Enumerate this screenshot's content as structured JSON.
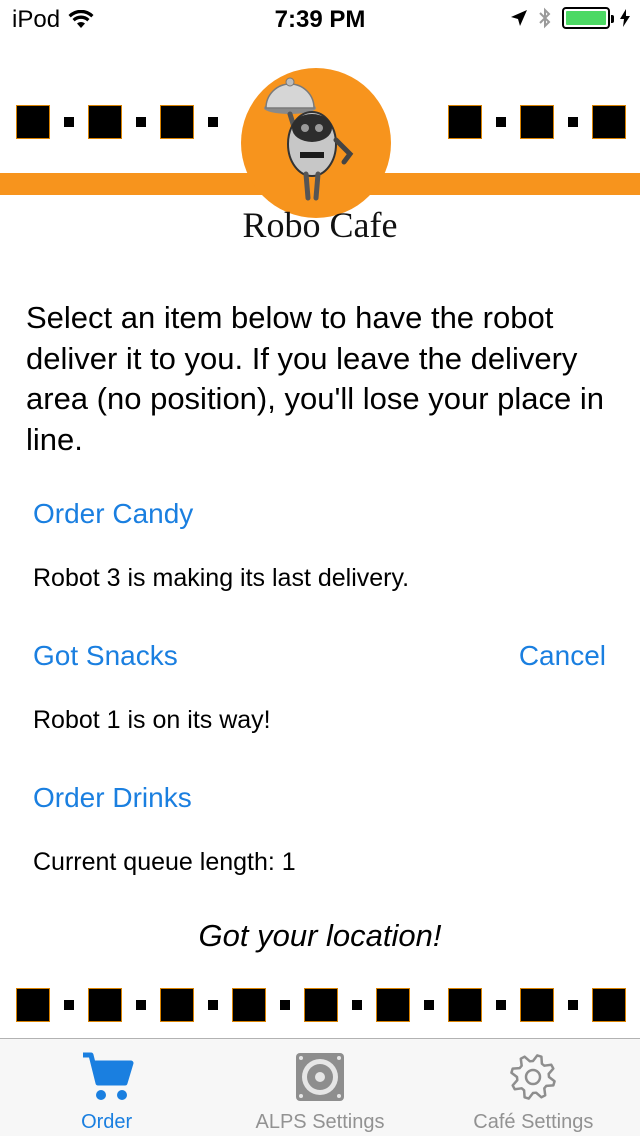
{
  "status_bar": {
    "carrier": "iPod",
    "time": "7:39 PM"
  },
  "header": {
    "title": "Robo Cafe",
    "brand_color": "#f7941d"
  },
  "intro_text": "Select an item below to have the robot deliver it to you. If you leave the delivery area (no position), you'll lose your place in line.",
  "orders": [
    {
      "button_label": "Order Candy",
      "status": "Robot 3 is making its last delivery."
    },
    {
      "button_label": "Got Snacks",
      "status": "Robot 1 is on its way!",
      "cancel_label": "Cancel"
    },
    {
      "button_label": "Order Drinks",
      "status": "Current queue length: 1"
    }
  ],
  "location_status": "Got your location!",
  "tab_bar": {
    "active_color": "#1a7fe0",
    "tabs": [
      {
        "label": "Order",
        "icon": "cart-icon",
        "active": true
      },
      {
        "label": "ALPS Settings",
        "icon": "speaker-icon",
        "active": false
      },
      {
        "label": "Café Settings",
        "icon": "gear-icon",
        "active": false
      }
    ]
  }
}
